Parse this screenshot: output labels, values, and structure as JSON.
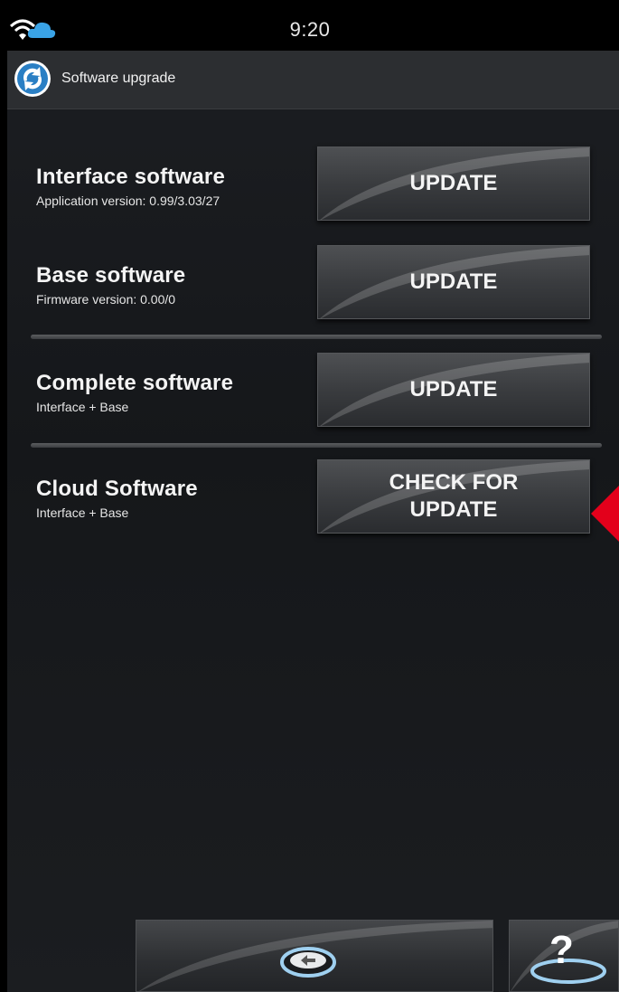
{
  "status_bar": {
    "time": "9:20",
    "icons": [
      "wifi-icon",
      "cloud-icon"
    ]
  },
  "action_bar": {
    "title": "Software upgrade",
    "icon": "sync-icon"
  },
  "rows": [
    {
      "title": "Interface software",
      "subtitle": "Application version: 0.99/3.03/27",
      "button": "UPDATE"
    },
    {
      "title": "Base software",
      "subtitle": "Firmware version: 0.00/0",
      "button": "UPDATE"
    },
    {
      "title": "Complete software",
      "subtitle": "Interface + Base",
      "button": "UPDATE"
    },
    {
      "title": "Cloud Software",
      "subtitle": "Interface + Base",
      "button_line1": "CHECK FOR",
      "button_line2": "UPDATE"
    }
  ],
  "bottom_nav": {
    "back_icon": "back-arrow-icon",
    "help_icon": "help-icon",
    "help_glyph": "?"
  },
  "colors": {
    "highlight_arrow": "#e3001b",
    "background": "#17191c",
    "button": "#3e4043"
  }
}
